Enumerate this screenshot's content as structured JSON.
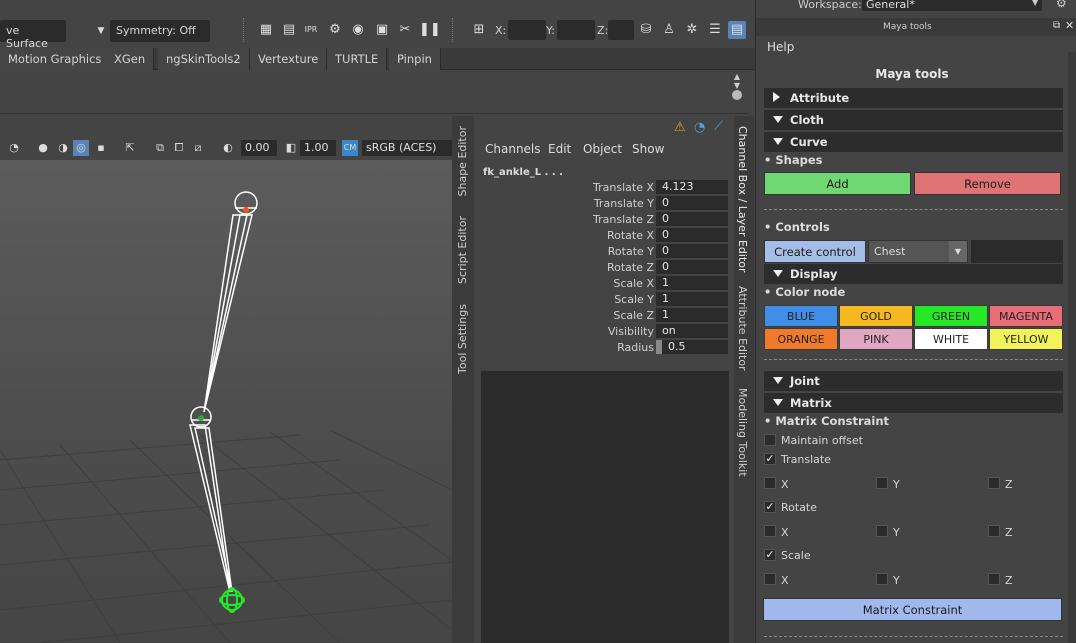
{
  "toolbar": {
    "surface_label": "ve Surface",
    "symmetry_label": "Symmetry: Off",
    "x_label": "X:",
    "y_label": "Y:",
    "z_label": "Z:",
    "workspace_label": "Workspace:",
    "workspace_value": "General*"
  },
  "shelf": {
    "tabs": [
      "Motion Graphics",
      "XGen",
      "ngSkinTools2",
      "Vertexture",
      "TURTLE",
      "Pinpin"
    ]
  },
  "viewport": {
    "exposure": "0.00",
    "gamma": "1.00",
    "color_space": "sRGB (ACES)"
  },
  "side_tabs": {
    "left": [
      "Shape Editor",
      "Script Editor",
      "Tool Settings"
    ],
    "right": [
      "Channel Box / Layer Editor",
      "Attribute Editor",
      "Modeling Toolkit"
    ]
  },
  "channel_box": {
    "menus": [
      "Channels",
      "Edit",
      "Object",
      "Show"
    ],
    "object_name": "fk_ankle_L . . .",
    "rows": [
      {
        "label": "Translate X",
        "value": "4.123"
      },
      {
        "label": "Translate Y",
        "value": "0"
      },
      {
        "label": "Translate Z",
        "value": "0"
      },
      {
        "label": "Rotate X",
        "value": "0"
      },
      {
        "label": "Rotate Y",
        "value": "0"
      },
      {
        "label": "Rotate Z",
        "value": "0"
      },
      {
        "label": "Scale X",
        "value": "1"
      },
      {
        "label": "Scale Y",
        "value": "1"
      },
      {
        "label": "Scale Z",
        "value": "1"
      },
      {
        "label": "Visibility",
        "value": "on"
      },
      {
        "label": "Radius",
        "value": "0.5"
      }
    ]
  },
  "maya_tools": {
    "window_title": "Maya tools",
    "help_menu": "Help",
    "title": "Maya tools",
    "sections": {
      "attribute": "Attribute",
      "cloth": "Cloth",
      "curve": "Curve",
      "display": "Display",
      "joint": "Joint",
      "matrix": "Matrix"
    },
    "shapes_label": "Shapes",
    "add_label": "Add",
    "remove_label": "Remove",
    "controls_label": "Controls",
    "create_control_label": "Create control",
    "control_shape_value": "Chest",
    "control_name_value": "",
    "color_node_label": "Color node",
    "colors": [
      {
        "label": "BLUE",
        "color": "#3f8fe8"
      },
      {
        "label": "GOLD",
        "color": "#f5b820"
      },
      {
        "label": "GREEN",
        "color": "#27e827"
      },
      {
        "label": "MAGENTA",
        "color": "#e86d77"
      },
      {
        "label": "ORANGE",
        "color": "#f07a2a"
      },
      {
        "label": "PINK",
        "color": "#e0a6c2"
      },
      {
        "label": "WHITE",
        "color": "#ffffff"
      },
      {
        "label": "YELLOW",
        "color": "#f2f25a"
      }
    ],
    "matrix_constraint_label": "Matrix Constraint",
    "maintain_offset_label": "Maintain offset",
    "maintain_offset_checked": false,
    "translate_label": "Translate",
    "translate_checked": true,
    "rotate_label": "Rotate",
    "rotate_checked": true,
    "scale_label": "Scale",
    "scale_checked": true,
    "axis_labels": [
      "X",
      "Y",
      "Z"
    ],
    "matrix_constraint_button": "Matrix Constraint",
    "accent_colors": {
      "add": "#6fd873",
      "remove": "#e07474",
      "create_control": "#a6bde8",
      "matrix_constraint": "#a1b8ec"
    }
  }
}
